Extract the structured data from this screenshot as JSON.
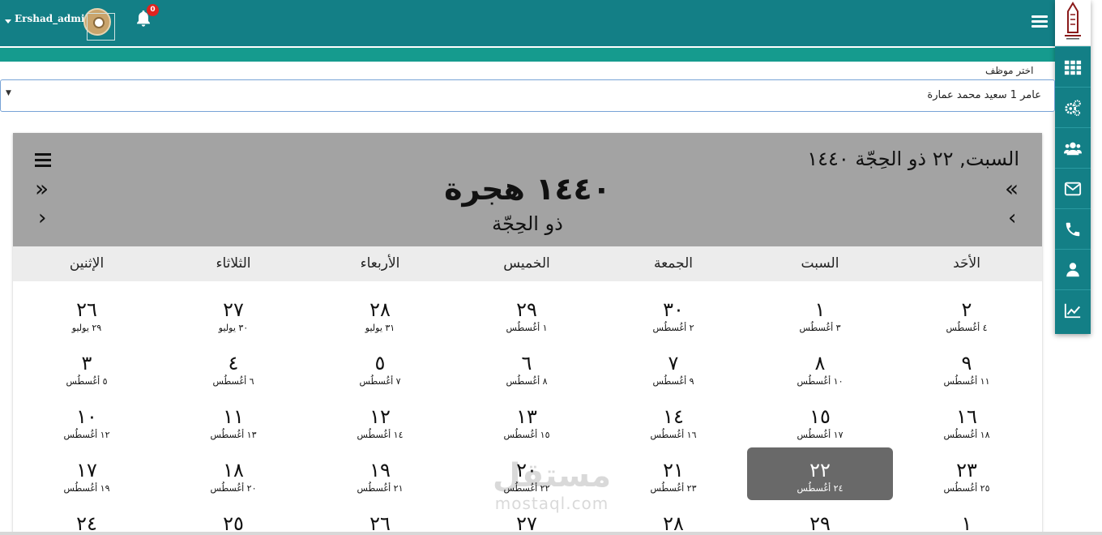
{
  "header": {
    "username": "Ershad_admin",
    "notification_count": "0"
  },
  "colors": {
    "topbar": "#137f86",
    "accent_strip": "#159b8e",
    "calendar_header": "#a3a3a3",
    "selected_day": "#696969",
    "badge": "#e0231f"
  },
  "sidebar": {
    "items": [
      {
        "icon": "grid-icon"
      },
      {
        "icon": "gears-icon"
      },
      {
        "icon": "users-icon"
      },
      {
        "icon": "envelope-icon"
      },
      {
        "icon": "phone-icon"
      },
      {
        "icon": "user-icon"
      },
      {
        "icon": "line-chart-icon"
      }
    ]
  },
  "employee": {
    "label": "اختر موظف",
    "selected": "عامر 1 سعيد محمد عمارة"
  },
  "calendar": {
    "current_date": "السبت, ٢٢ ذو الحِجّة ١٤٤٠",
    "year": "١٤٤٠ هجرة",
    "month": "ذو الحِجّة",
    "nav_prev_year": "«",
    "nav_prev_month": "‹",
    "nav_next_year": "»",
    "nav_next_month": "›",
    "weekdays": [
      "الأحَد",
      "السبت",
      "الجمعة",
      "الخميس",
      "الأربعاء",
      "الثلاثاء",
      "الإثنين"
    ],
    "weeks": [
      [
        {
          "h": "٢",
          "g": "٤ أغُسطُس"
        },
        {
          "h": "١",
          "g": "٣ أغُسطُس"
        },
        {
          "h": "٣٠",
          "g": "٢ أغُسطُس"
        },
        {
          "h": "٢٩",
          "g": "١ أغُسطُس"
        },
        {
          "h": "٢٨",
          "g": "٣١ يوليو"
        },
        {
          "h": "٢٧",
          "g": "٣٠ يوليو"
        },
        {
          "h": "٢٦",
          "g": "٢٩ يوليو"
        }
      ],
      [
        {
          "h": "٩",
          "g": "١١ أغُسطُس"
        },
        {
          "h": "٨",
          "g": "١٠ أغُسطُس"
        },
        {
          "h": "٧",
          "g": "٩ أغُسطُس"
        },
        {
          "h": "٦",
          "g": "٨ أغُسطُس"
        },
        {
          "h": "٥",
          "g": "٧ أغُسطُس"
        },
        {
          "h": "٤",
          "g": "٦ أغُسطُس"
        },
        {
          "h": "٣",
          "g": "٥ أغُسطُس"
        }
      ],
      [
        {
          "h": "١٦",
          "g": "١٨ أغُسطُس"
        },
        {
          "h": "١٥",
          "g": "١٧ أغُسطُس"
        },
        {
          "h": "١٤",
          "g": "١٦ أغُسطُس"
        },
        {
          "h": "١٣",
          "g": "١٥ أغُسطُس"
        },
        {
          "h": "١٢",
          "g": "١٤ أغُسطُس"
        },
        {
          "h": "١١",
          "g": "١٣ أغُسطُس"
        },
        {
          "h": "١٠",
          "g": "١٢ أغُسطُس"
        }
      ],
      [
        {
          "h": "٢٣",
          "g": "٢٥ أغُسطُس"
        },
        {
          "h": "٢٢",
          "g": "٢٤ أغُسطُس",
          "selected": true
        },
        {
          "h": "٢١",
          "g": "٢٣ أغُسطُس"
        },
        {
          "h": "٢٠",
          "g": "٢٢ أغُسطُس"
        },
        {
          "h": "١٩",
          "g": "٢١ أغُسطُس"
        },
        {
          "h": "١٨",
          "g": "٢٠ أغُسطُس"
        },
        {
          "h": "١٧",
          "g": "١٩ أغُسطُس"
        }
      ],
      [
        {
          "h": "١",
          "g": ""
        },
        {
          "h": "٢٩",
          "g": ""
        },
        {
          "h": "٢٨",
          "g": ""
        },
        {
          "h": "٢٧",
          "g": ""
        },
        {
          "h": "٢٦",
          "g": ""
        },
        {
          "h": "٢٥",
          "g": ""
        },
        {
          "h": "٢٤",
          "g": ""
        }
      ]
    ]
  },
  "watermark": {
    "brand": "مستقل",
    "domain": "mostaql.com"
  }
}
